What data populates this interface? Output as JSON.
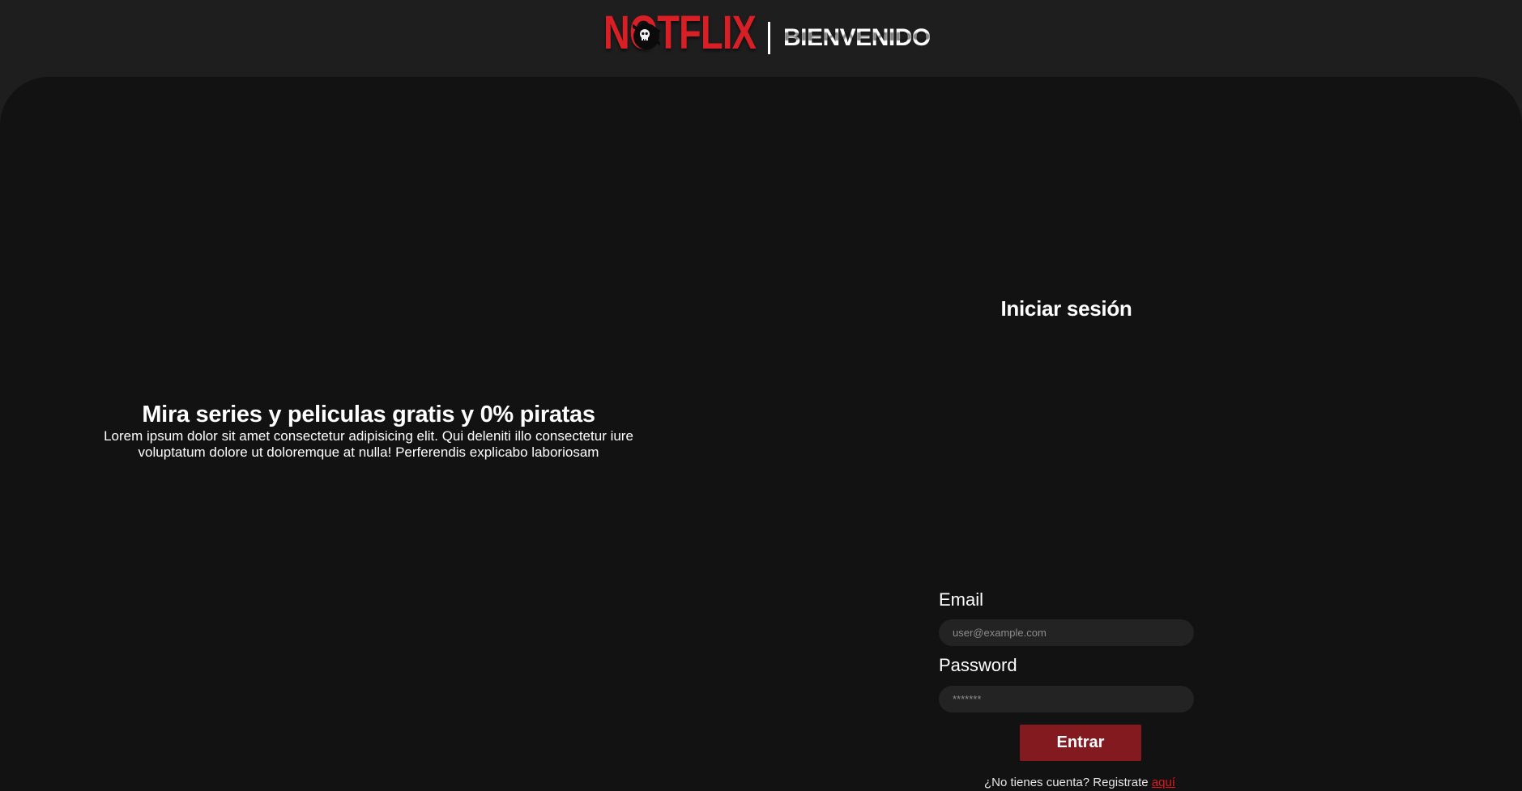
{
  "header": {
    "logo_text": "NOTFLIX",
    "title": "BIENVENIDO"
  },
  "hero": {
    "title": "Mira series y peliculas gratis y 0% piratas",
    "description": "Lorem ipsum dolor sit amet consectetur adipisicing elit. Qui deleniti illo consectetur iure voluptatum dolore ut doloremque at nulla! Perferendis explicabo laboriosam"
  },
  "login": {
    "title": "Iniciar sesión",
    "email_label": "Email",
    "email_placeholder": "user@example.com",
    "password_label": "Password",
    "password_placeholder": "*******",
    "submit_label": "Entrar",
    "register_text": "¿No tienes cuenta? Registrate ",
    "register_link": "aquí"
  },
  "colors": {
    "brand_red": "#d81f26",
    "button_red": "#831a20",
    "link_red": "#e0161d",
    "panel_bg": "#121212",
    "header_bg": "#1f1e1f",
    "input_bg": "#232323"
  },
  "icons": {
    "logo_skull": "skull-icon"
  }
}
